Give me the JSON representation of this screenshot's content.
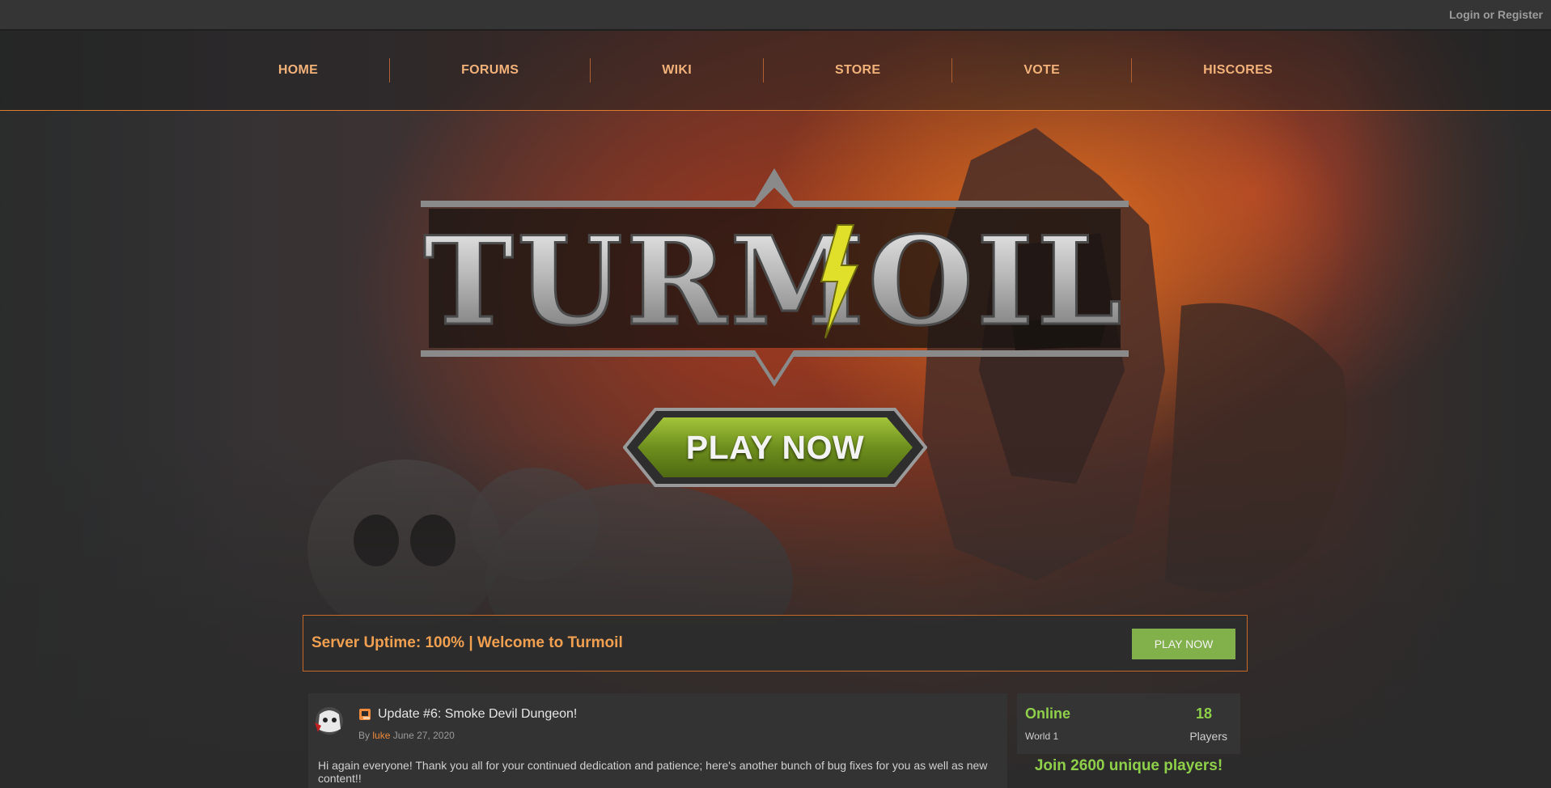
{
  "topbar": {
    "login_label": "Login or Register"
  },
  "nav": {
    "items": [
      {
        "label": "HOME"
      },
      {
        "label": "FORUMS"
      },
      {
        "label": "WIKI"
      },
      {
        "label": "STORE"
      },
      {
        "label": "VOTE"
      },
      {
        "label": "HISCORES"
      }
    ]
  },
  "hero": {
    "logo_text": "TURMOIL",
    "play_button": "PLAY NOW"
  },
  "banner": {
    "text": "Server Uptime: 100% | Welcome to Turmoil",
    "button": "PLAY NOW"
  },
  "post": {
    "title": "Update #6: Smoke Devil Dungeon!",
    "by_label": "By",
    "author": "luke",
    "date": "June 27, 2020",
    "body": "Hi again everyone! Thank you all for your continued dedication and patience; here's another bunch of bug fixes for you as well as new content!!",
    "icon": "news-scroll-icon"
  },
  "status": {
    "online_label": "Online",
    "world": "World 1",
    "count": "18",
    "players_label": "Players",
    "join_text": "Join 2600 unique players!"
  },
  "colors": {
    "accent_orange": "#f08a3c",
    "nav_text": "#f2b27a",
    "online_green": "#8fd04a",
    "button_green": "#82b04b"
  }
}
